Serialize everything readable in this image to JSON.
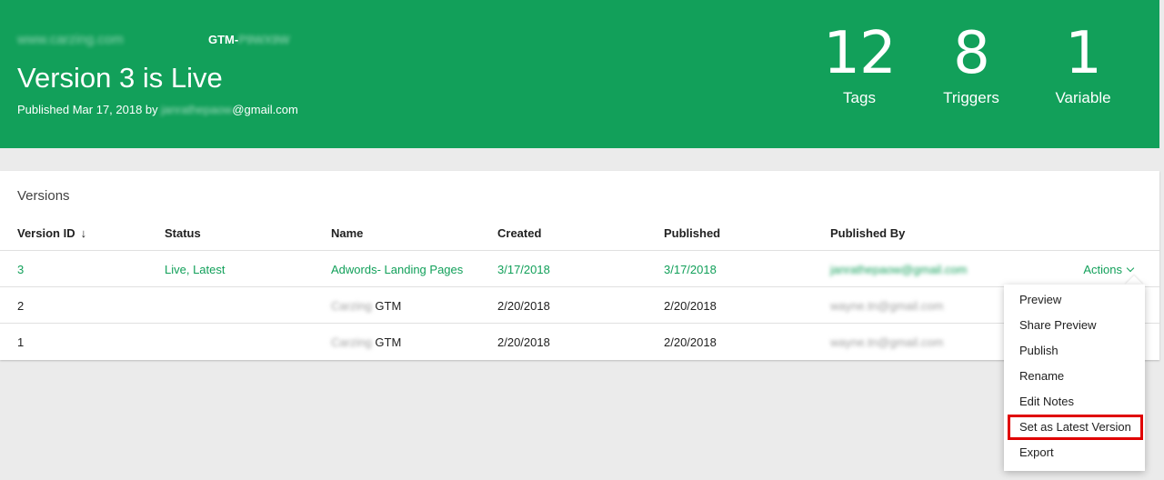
{
  "header": {
    "site": "www.carzing.com",
    "gtm_prefix": "GTM-",
    "gtm_id": "P9WX9W",
    "title": "Version 3 is Live",
    "published_prefix": "Published Mar 17, 2018 by ",
    "published_user": "janrathepaow",
    "published_domain": "@gmail.com"
  },
  "stats": [
    {
      "value": "12",
      "label": "Tags"
    },
    {
      "value": "8",
      "label": "Triggers"
    },
    {
      "value": "1",
      "label": "Variable"
    }
  ],
  "versions": {
    "title": "Versions",
    "columns": [
      "Version ID",
      "Status",
      "Name",
      "Created",
      "Published",
      "Published By"
    ],
    "sort_icon": "arrow-down-icon",
    "rows": [
      {
        "id": "3",
        "status": "Live, Latest",
        "name_prefix": "",
        "name": "Adwords- Landing Pages",
        "created": "3/17/2018",
        "published": "3/17/2018",
        "published_by": "janrathepaow@gmail.com"
      },
      {
        "id": "2",
        "status": "",
        "name_prefix": "Carzing",
        "name": " GTM",
        "created": "2/20/2018",
        "published": "2/20/2018",
        "published_by": "wayne.tn@gmail.com"
      },
      {
        "id": "1",
        "status": "",
        "name_prefix": "Carzing",
        "name": " GTM",
        "created": "2/20/2018",
        "published": "2/20/2018",
        "published_by": "wayne.tn@gmail.com"
      }
    ],
    "actions_label": "Actions"
  },
  "menu": {
    "items": [
      "Preview",
      "Share Preview",
      "Publish",
      "Rename",
      "Edit Notes",
      "Set as Latest Version",
      "Export"
    ]
  },
  "colors": {
    "brand_green": "#12a05a",
    "highlight_red": "#e00000"
  }
}
